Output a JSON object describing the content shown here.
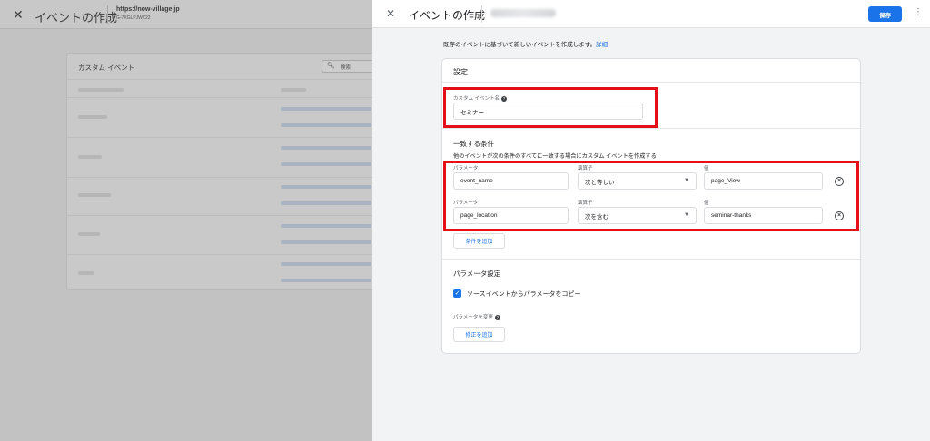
{
  "background": {
    "title": "イベントの作成",
    "site": "https://now-village.jp",
    "stream_id": "G-7XGLPJWZ22",
    "card_title": "カスタム イベント",
    "search_placeholder": "検索"
  },
  "panel": {
    "title": "イベントの作成",
    "save_label": "保存",
    "intro_text": "既存のイベントに基づいて新しいイベントを作成します。",
    "intro_link": "詳細",
    "settings_title": "設定",
    "event_name_label": "カスタム イベント名",
    "event_name_value": "セミナー",
    "conditions": {
      "title": "一致する条件",
      "subtitle": "他のイベントが次の条件のすべてに一致する場合にカスタム イベントを作成する",
      "rows": [
        {
          "param_label": "パラメータ",
          "param_value": "event_name",
          "operator_label": "演算子",
          "operator_value": "次と等しい",
          "value_label": "値",
          "value_value": "page_View"
        },
        {
          "param_label": "パラメータ",
          "param_value": "page_location",
          "operator_label": "演算子",
          "operator_value": "次を含む",
          "value_label": "値",
          "value_value": "seminar-thanks"
        }
      ],
      "add_button": "条件を追加"
    },
    "params": {
      "title": "パラメータ設定",
      "copy_checkbox_label": "ソースイベントからパラメータをコピー",
      "copy_checked": true,
      "modify_label": "パラメータを変更",
      "add_button": "修正を追加"
    }
  },
  "colors": {
    "accent": "#1a73e8",
    "highlight": "#e3101a"
  }
}
